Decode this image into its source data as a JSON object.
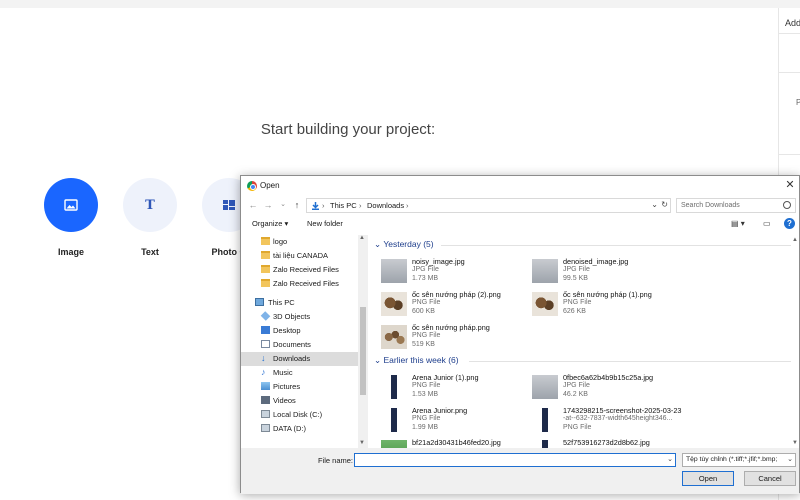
{
  "app": {
    "start_title": "Start building your project:",
    "tools": [
      {
        "label": "Image",
        "icon": "image-icon"
      },
      {
        "label": "Text",
        "icon": "text-icon",
        "glyph": "T"
      },
      {
        "label": "Photo G",
        "icon": "photo-grid-icon"
      }
    ],
    "right_panel": {
      "label": "Add C",
      "p_text": "P"
    }
  },
  "dialog": {
    "title": "Open",
    "close": "✕",
    "breadcrumb": [
      "This PC",
      "Downloads"
    ],
    "search_placeholder": "Search Downloads",
    "toolbar": {
      "organize": "Organize ▾",
      "new_folder": "New folder",
      "help": "?"
    },
    "nav": [
      {
        "label": "logo",
        "icon": "folder-icon"
      },
      {
        "label": "tài liệu CANADA",
        "icon": "folder-icon"
      },
      {
        "label": "Zalo Received Files",
        "icon": "folder-icon"
      },
      {
        "label": "Zalo Received Files",
        "icon": "folder-icon"
      },
      {
        "label": "This PC",
        "icon": "computer-icon"
      },
      {
        "label": "3D Objects",
        "icon": "3d-objects-icon"
      },
      {
        "label": "Desktop",
        "icon": "desktop-icon"
      },
      {
        "label": "Documents",
        "icon": "documents-icon"
      },
      {
        "label": "Downloads",
        "icon": "downloads-icon",
        "selected": true
      },
      {
        "label": "Music",
        "icon": "music-icon"
      },
      {
        "label": "Pictures",
        "icon": "pictures-icon"
      },
      {
        "label": "Videos",
        "icon": "videos-icon"
      },
      {
        "label": "Local Disk (C:)",
        "icon": "drive-icon"
      },
      {
        "label": "DATA (D:)",
        "icon": "drive-icon"
      }
    ],
    "groups": [
      {
        "header": "Yesterday (5)",
        "files": [
          {
            "name": "noisy_image.jpg",
            "type": "JPG File",
            "size": "1.73 MB",
            "thumb": "gray"
          },
          {
            "name": "denoised_image.jpg",
            "type": "JPG File",
            "size": "99.5 KB",
            "thumb": "gray"
          },
          {
            "name": "ốc sên nướng pháp (2).png",
            "type": "PNG File",
            "size": "600 KB",
            "thumb": "food"
          },
          {
            "name": "ốc sên nướng pháp (1).png",
            "type": "PNG File",
            "size": "626 KB",
            "thumb": "food"
          },
          {
            "name": "ốc sên nướng pháp.png",
            "type": "PNG File",
            "size": "519 KB",
            "thumb": "food2"
          }
        ]
      },
      {
        "header": "Earlier this week (6)",
        "files": [
          {
            "name": "Arena Junior (1).png",
            "type": "PNG File",
            "size": "1.53 MB",
            "thumb": "person"
          },
          {
            "name": "0fbec6a62b4b9b15c25a.jpg",
            "type": "JPG File",
            "size": "46.2 KB",
            "thumb": "gray"
          },
          {
            "name": "Arena Junior.png",
            "type": "PNG File",
            "size": "1.99 MB",
            "thumb": "person"
          },
          {
            "name": "1743298215-screenshot-2025-03-23",
            "type": "-at--632-7837-width645height346...",
            "size": "PNG File",
            "thumb": "person"
          },
          {
            "name": "bf21a2d30431b46fed20.jpg",
            "type": "",
            "size": "",
            "thumb": "green"
          },
          {
            "name": "52f753916273d2d8b62.jpg",
            "type": "",
            "size": "",
            "thumb": "person"
          }
        ]
      }
    ],
    "file_name_label": "File name:",
    "file_name_value": "",
    "filter": "Tệp tùy chỉnh (*.tiff;*.jfif;*.bmp;",
    "open_label": "Open",
    "cancel_label": "Cancel"
  }
}
